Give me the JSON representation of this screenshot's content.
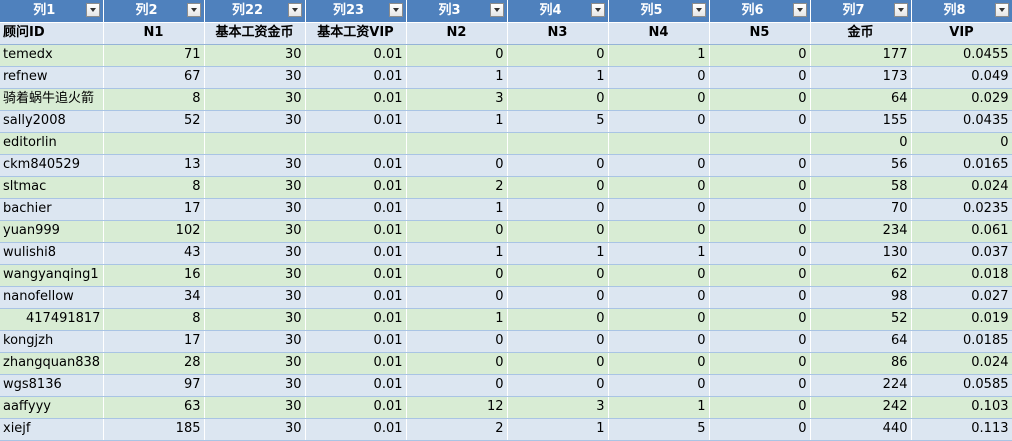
{
  "columns": [
    "列1",
    "列2",
    "列22",
    "列23",
    "列3",
    "列4",
    "列5",
    "列6",
    "列7",
    "列8"
  ],
  "subheaders": [
    "顾问ID",
    "N1",
    "基本工资金币",
    "基本工资VIP",
    "N2",
    "N3",
    "N4",
    "N5",
    "金币",
    "VIP"
  ],
  "rows": [
    [
      "temedx",
      "71",
      "30",
      "0.01",
      "0",
      "0",
      "1",
      "0",
      "177",
      "0.0455"
    ],
    [
      "refnew",
      "67",
      "30",
      "0.01",
      "1",
      "1",
      "0",
      "0",
      "173",
      "0.049"
    ],
    [
      "骑着蜗牛追火箭",
      "8",
      "30",
      "0.01",
      "3",
      "0",
      "0",
      "0",
      "64",
      "0.029"
    ],
    [
      "sally2008",
      "52",
      "30",
      "0.01",
      "1",
      "5",
      "0",
      "0",
      "155",
      "0.0435"
    ],
    [
      "editorlin",
      "",
      "",
      "",
      "",
      "",
      "",
      "",
      "0",
      "0"
    ],
    [
      "ckm840529",
      "13",
      "30",
      "0.01",
      "0",
      "0",
      "0",
      "0",
      "56",
      "0.0165"
    ],
    [
      "sltmac",
      "8",
      "30",
      "0.01",
      "2",
      "0",
      "0",
      "0",
      "58",
      "0.024"
    ],
    [
      "bachier",
      "17",
      "30",
      "0.01",
      "1",
      "0",
      "0",
      "0",
      "70",
      "0.0235"
    ],
    [
      "yuan999",
      "102",
      "30",
      "0.01",
      "0",
      "0",
      "0",
      "0",
      "234",
      "0.061"
    ],
    [
      "wulishi8",
      "43",
      "30",
      "0.01",
      "1",
      "1",
      "1",
      "0",
      "130",
      "0.037"
    ],
    [
      "wangyanqing1",
      "16",
      "30",
      "0.01",
      "0",
      "0",
      "0",
      "0",
      "62",
      "0.018"
    ],
    [
      "nanofellow",
      "34",
      "30",
      "0.01",
      "0",
      "0",
      "0",
      "0",
      "98",
      "0.027"
    ],
    [
      "417491817",
      "8",
      "30",
      "0.01",
      "1",
      "0",
      "0",
      "0",
      "52",
      "0.019"
    ],
    [
      "kongjzh",
      "17",
      "30",
      "0.01",
      "0",
      "0",
      "0",
      "0",
      "64",
      "0.0185"
    ],
    [
      "zhangquan838",
      "28",
      "30",
      "0.01",
      "0",
      "0",
      "0",
      "0",
      "86",
      "0.024"
    ],
    [
      "wgs8136",
      "97",
      "30",
      "0.01",
      "0",
      "0",
      "0",
      "0",
      "224",
      "0.0585"
    ],
    [
      "aaffyyy",
      "63",
      "30",
      "0.01",
      "12",
      "3",
      "1",
      "0",
      "242",
      "0.103"
    ],
    [
      "xiejf",
      "185",
      "30",
      "0.01",
      "2",
      "1",
      "5",
      "0",
      "440",
      "0.113"
    ]
  ],
  "icons": {
    "filter_button": "dropdown-filter-icon"
  },
  "colors": {
    "header_blue": "#4f81bd",
    "row_green": "#d8ecd4",
    "row_blue": "#dce6f1"
  }
}
